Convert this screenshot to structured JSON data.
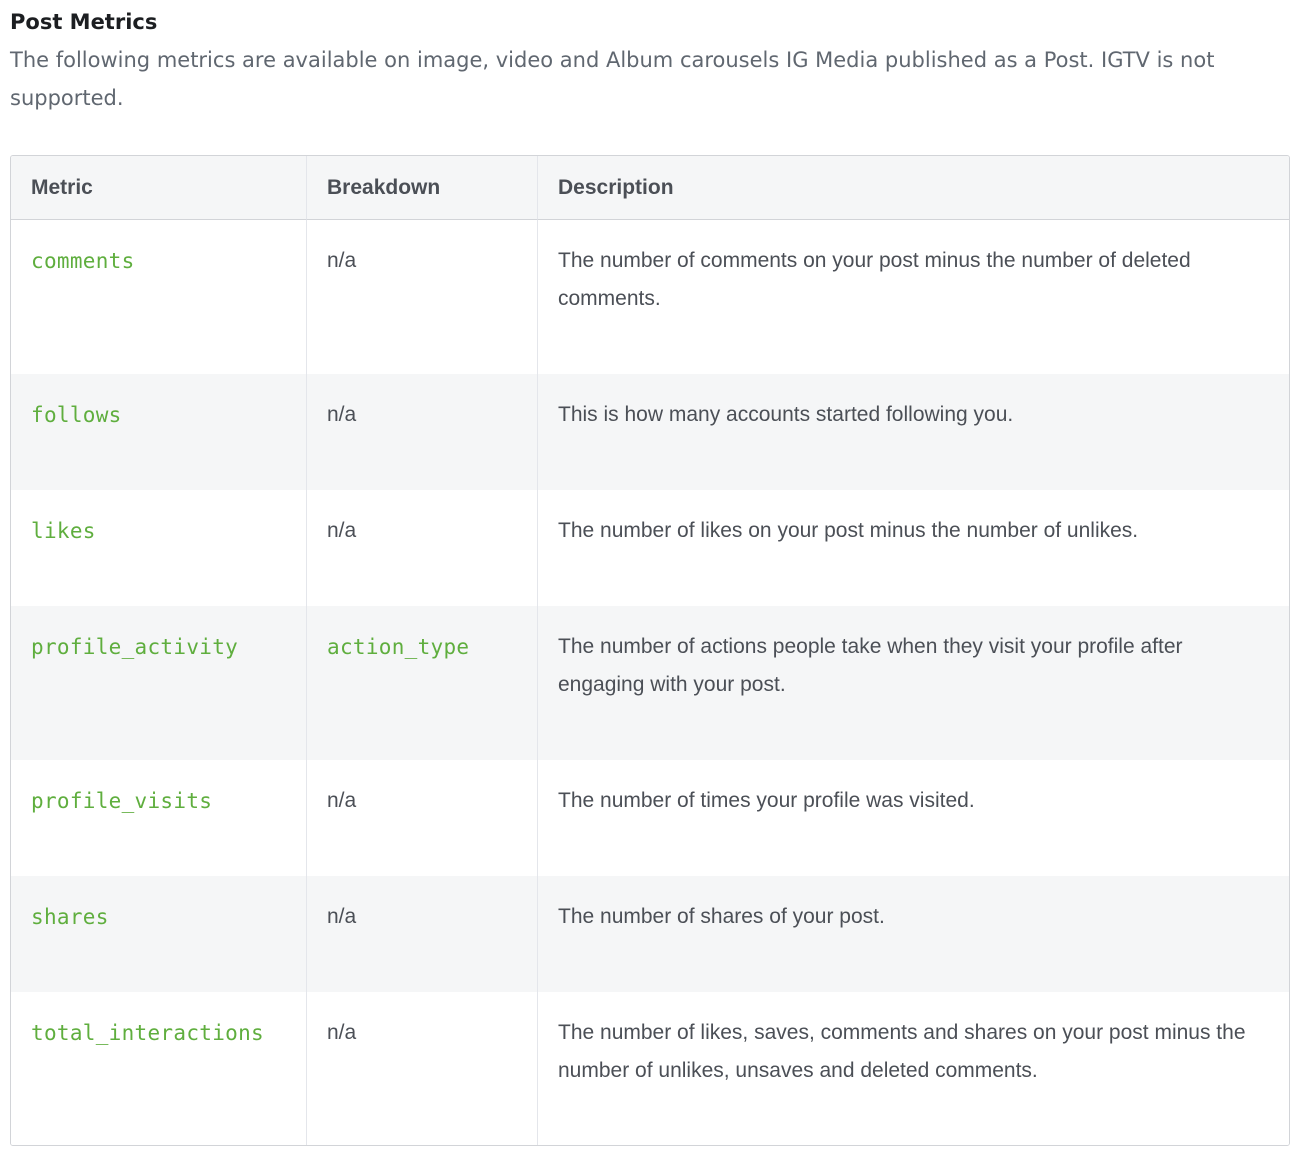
{
  "section": {
    "title": "Post Metrics",
    "intro": "The following metrics are available on image, video and Album carousels IG Media published as a Post. IGTV is not supported."
  },
  "table": {
    "headers": {
      "metric": "Metric",
      "breakdown": "Breakdown",
      "description": "Description"
    },
    "rows": [
      {
        "metric": "comments",
        "breakdown": "n/a",
        "description": "The number of comments on your post minus the number of deleted comments."
      },
      {
        "metric": "follows",
        "breakdown": "n/a",
        "description": "This is how many accounts started following you."
      },
      {
        "metric": "likes",
        "breakdown": "n/a",
        "description": "The number of likes on your post minus the number of unlikes."
      },
      {
        "metric": "profile_activity",
        "breakdown": "action_type",
        "description": "The number of actions people take when they visit your profile after engaging with your post."
      },
      {
        "metric": "profile_visits",
        "breakdown": "n/a",
        "description": "The number of times your profile was visited."
      },
      {
        "metric": "shares",
        "breakdown": "n/a",
        "description": "The number of shares of your post."
      },
      {
        "metric": "total_interactions",
        "breakdown": "n/a",
        "description": "The number of likes, saves, comments and shares on your post minus the number of unlikes, unsaves and deleted comments."
      }
    ]
  },
  "colors": {
    "code_text": "#5fae3e",
    "header_bg": "#f5f6f7",
    "body_text": "#4b4f56"
  }
}
